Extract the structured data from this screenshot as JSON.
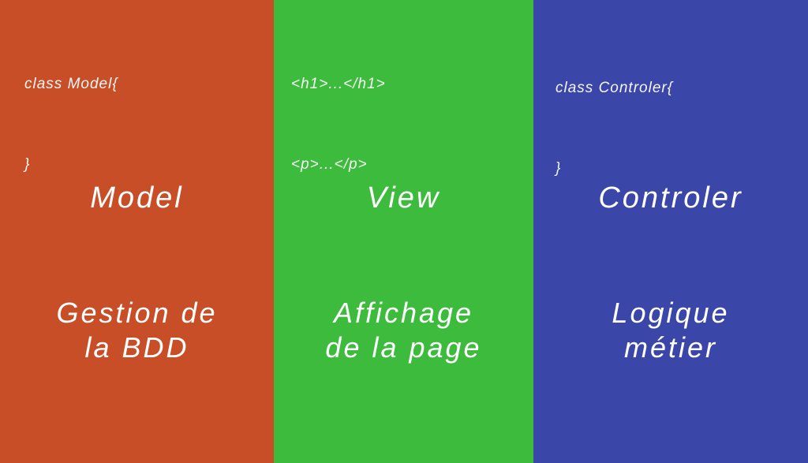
{
  "colors": {
    "model_bg": "#C84E28",
    "view_bg": "#3DBB3D",
    "controler_bg": "#3B47A8",
    "text": "#FFFFFF"
  },
  "columns": [
    {
      "code_lines": [
        "class Model{",
        "}"
      ],
      "title": "Model",
      "description_lines": [
        "Gestion de",
        "la BDD"
      ]
    },
    {
      "code_lines": [
        "<h1>...</h1>",
        "<p>...</p>"
      ],
      "title": "View",
      "description_lines": [
        "Affichage",
        "de la page"
      ]
    },
    {
      "code_lines": [
        "class Controler{",
        "}"
      ],
      "title": "Controler",
      "description_lines": [
        "Logique",
        "métier"
      ]
    }
  ]
}
